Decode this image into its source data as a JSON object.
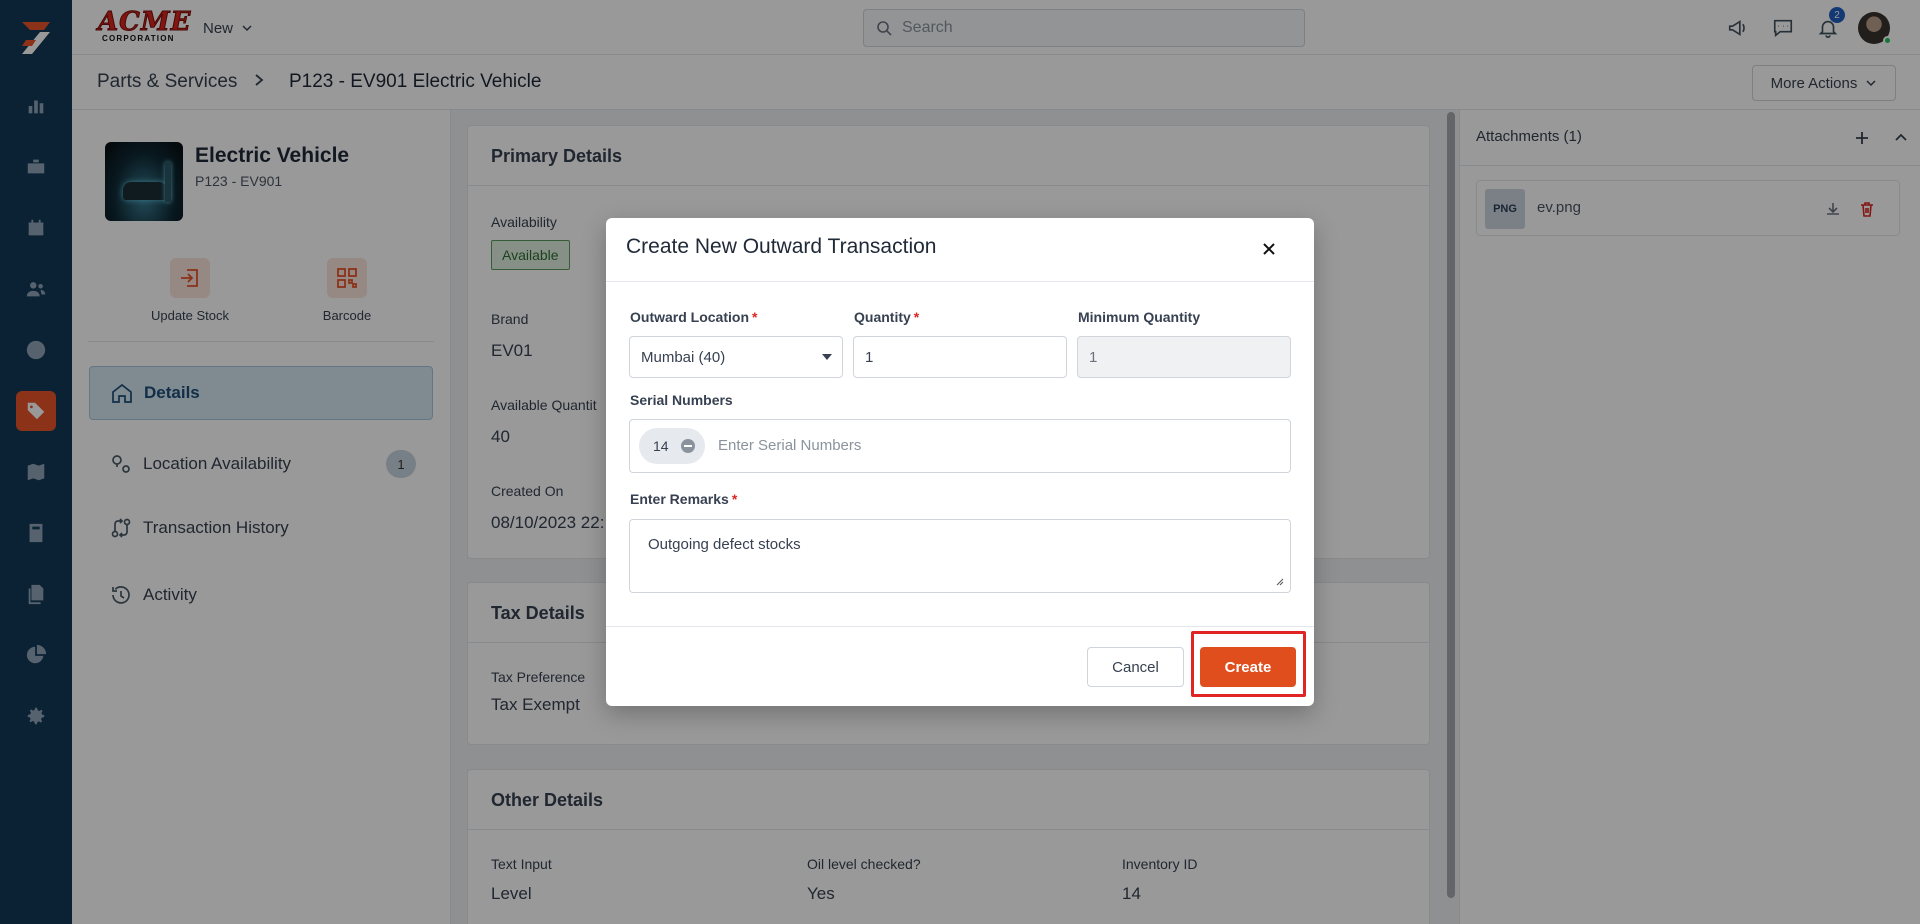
{
  "topbar": {
    "brand_line1": "ACME",
    "brand_line2": "CORPORATION",
    "new_label": "New",
    "search_placeholder": "Search",
    "notification_count": "2"
  },
  "breadcrumb": {
    "parent": "Parts & Services",
    "current": "P123 - EV901 Electric Vehicle",
    "more_actions": "More Actions"
  },
  "product": {
    "name": "Electric Vehicle",
    "code": "P123 - EV901",
    "actions": [
      {
        "label": "Update Stock",
        "icon": "update-stock-icon"
      },
      {
        "label": "Barcode",
        "icon": "qr-code-icon"
      }
    ]
  },
  "nav": [
    {
      "label": "Details",
      "icon": "home-icon",
      "active": true
    },
    {
      "label": "Location Availability",
      "icon": "location-pin-icon",
      "count": "1"
    },
    {
      "label": "Transaction History",
      "icon": "transaction-icon"
    },
    {
      "label": "Activity",
      "icon": "history-icon"
    }
  ],
  "primary_details": {
    "title": "Primary Details",
    "availability_label": "Availability",
    "availability_value": "Available",
    "brand_label": "Brand",
    "brand_value": "EV01",
    "available_qty_label": "Available Quantit",
    "available_qty_value": "40",
    "created_on_label": "Created On",
    "created_on_value": "08/10/2023 22:"
  },
  "tax_details": {
    "title": "Tax Details",
    "pref_label": "Tax Preference",
    "pref_value": "Tax Exempt"
  },
  "other_details": {
    "title": "Other Details",
    "fields": [
      {
        "label": "Text Input",
        "value": "Level"
      },
      {
        "label": "Oil level checked?",
        "value": "Yes"
      },
      {
        "label": "Inventory ID",
        "value": "14"
      }
    ]
  },
  "attachments": {
    "title": "Attachments (1)",
    "files": [
      {
        "type": "PNG",
        "name": "ev.png"
      }
    ]
  },
  "modal": {
    "title": "Create New Outward Transaction",
    "outward_location_label": "Outward Location",
    "outward_location_value": "Mumbai (40)",
    "quantity_label": "Quantity",
    "quantity_value": "1",
    "min_quantity_label": "Minimum Quantity",
    "min_quantity_value": "1",
    "serial_label": "Serial Numbers",
    "serial_chip": "14",
    "serial_placeholder": "Enter Serial Numbers",
    "remarks_label": "Enter Remarks",
    "remarks_value": "Outgoing defect stocks",
    "cancel_label": "Cancel",
    "create_label": "Create",
    "required_mark": "*"
  },
  "colors": {
    "rail": "#123a57",
    "accent": "#e04e1d",
    "highlight": "#e02424"
  }
}
